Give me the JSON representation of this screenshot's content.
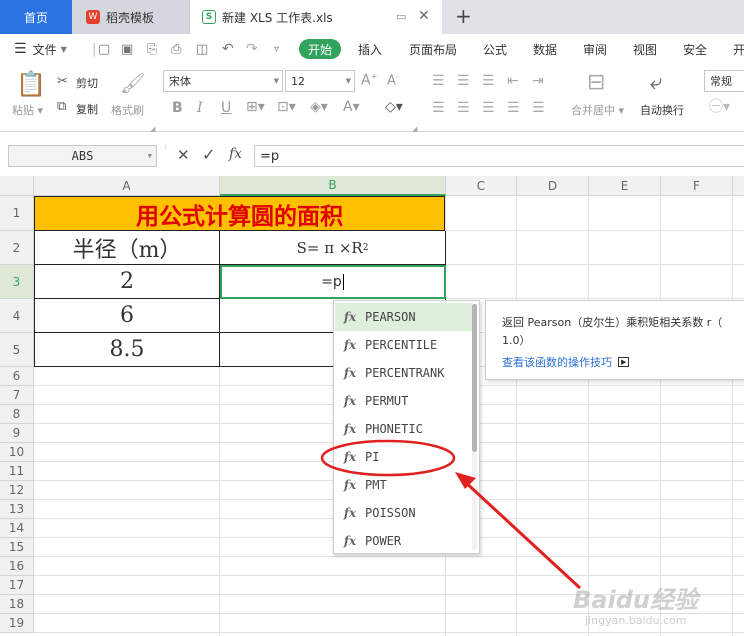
{
  "tabs": {
    "home": "首页",
    "template": "稻壳模板",
    "file": "新建 XLS 工作表.xls",
    "add": "+"
  },
  "menu": {
    "file": "文件",
    "items": [
      "开始",
      "插入",
      "页面布局",
      "公式",
      "数据",
      "审阅",
      "视图",
      "安全",
      "开"
    ]
  },
  "ribbon": {
    "paste": "粘贴",
    "cut": "剪切",
    "copy": "复制",
    "format_painter": "格式刷",
    "font_name": "宋体",
    "font_size": "12",
    "bold": "B",
    "italic": "I",
    "underline": "U",
    "merge": "合并居中",
    "wrap": "自动换行",
    "number_format": "常规",
    "font_grow": "A",
    "font_shrink": "A"
  },
  "formula_bar": {
    "name_box": "ABS",
    "fx": "fx",
    "formula": "=p"
  },
  "columns": [
    "A",
    "B",
    "C",
    "D",
    "E",
    "F"
  ],
  "rows": [
    "1",
    "2",
    "3",
    "4",
    "5",
    "6",
    "7",
    "8",
    "9",
    "10",
    "11",
    "12",
    "13",
    "14",
    "15",
    "16",
    "17",
    "18",
    "19"
  ],
  "cells": {
    "title": "用公式计算圆的面积",
    "radius_header": "半径（m）",
    "formula_header": "S= π ×R",
    "formula_sup": "2",
    "r1": "2",
    "r2": "6",
    "r3": "8.5",
    "editing": "=p"
  },
  "autocomplete": {
    "items": [
      "PEARSON",
      "PERCENTILE",
      "PERCENTRANK",
      "PERMUT",
      "PHONETIC",
      "PI",
      "PMT",
      "POISSON",
      "POWER"
    ],
    "selected": "PEARSON",
    "circled": "PI"
  },
  "tooltip": {
    "description": "返回 Pearson（皮尔生）乘积矩相关系数 r（",
    "description_cont": "1.0）",
    "link": "查看该函数的操作技巧"
  },
  "watermark": {
    "brand": "Baidu经验",
    "url": "jingyan.baidu.com"
  },
  "colors": {
    "accent_green": "#31a35c",
    "tab_blue": "#2b73e1",
    "title_fill": "#ffc000",
    "title_text": "#e00000",
    "annotation_red": "#e02020"
  }
}
